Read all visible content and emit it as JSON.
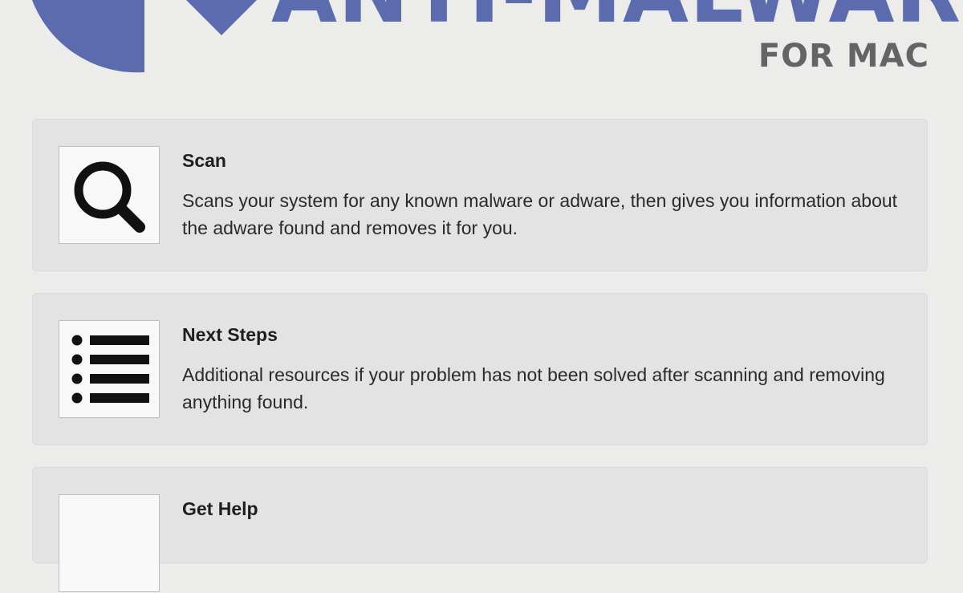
{
  "header": {
    "title": "ANTI-MALWARE",
    "subtitle": "FOR MAC",
    "brand_color": "#5b6bad",
    "subtitle_color": "#646464"
  },
  "cards": [
    {
      "icon": "magnifier-icon",
      "title": "Scan",
      "description": "Scans your system for any known malware or adware, then gives you information about the adware found and removes it for you."
    },
    {
      "icon": "list-icon",
      "title": "Next Steps",
      "description": "Additional resources if your problem has not been solved after scanning and removing anything found."
    },
    {
      "icon": "help-icon",
      "title": "Get Help",
      "description": ""
    }
  ]
}
